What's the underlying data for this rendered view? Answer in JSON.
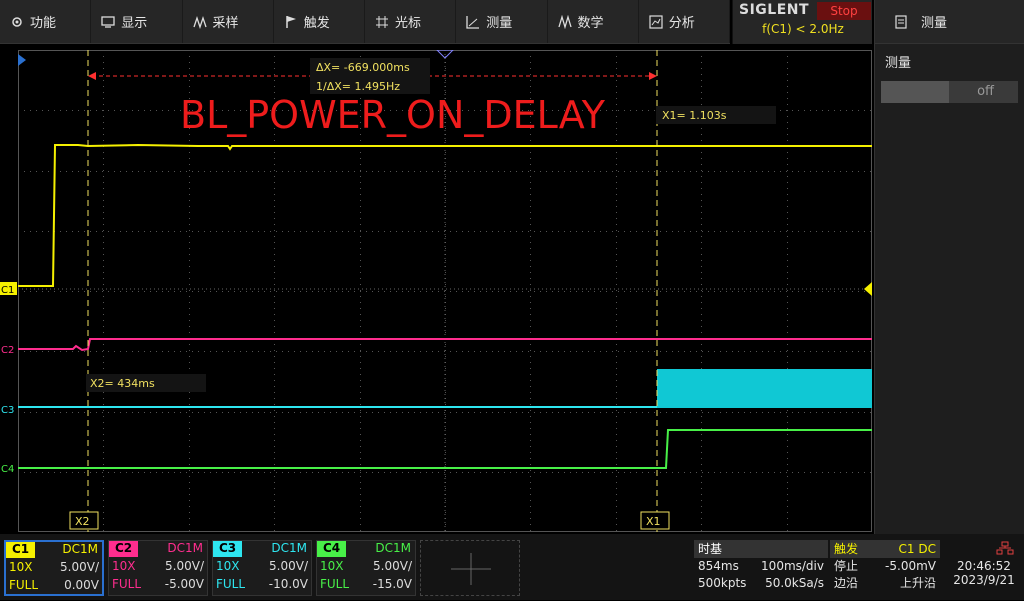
{
  "menu": [
    {
      "label": "功能",
      "icon": "gear-icon"
    },
    {
      "label": "显示",
      "icon": "monitor-icon"
    },
    {
      "label": "采样",
      "icon": "acquire-icon"
    },
    {
      "label": "触发",
      "icon": "flag-icon"
    },
    {
      "label": "光标",
      "icon": "cursor-icon"
    },
    {
      "label": "测量",
      "icon": "measure-icon"
    },
    {
      "label": "数学",
      "icon": "math-icon"
    },
    {
      "label": "分析",
      "icon": "analysis-icon"
    }
  ],
  "brand": {
    "name": "SIGLENT",
    "state": "Stop",
    "trigger_freq": "f(C1) < 2.0Hz"
  },
  "right_panel": {
    "title": "测量",
    "section": "测量",
    "toggle_value": "off"
  },
  "screen": {
    "title_annotation": "BL_POWER_ON_DELAY",
    "delta_x": "ΔX= -669.000ms",
    "inv_delta_x": "1/ΔX= 1.495Hz",
    "x1_label": "X1= 1.103s",
    "x2_label": "X2= 434ms",
    "x1_tag": "X1",
    "x2_tag": "X2",
    "ch_labels": [
      "C1",
      "C2",
      "C3",
      "C4"
    ]
  },
  "channels": [
    {
      "name": "C1",
      "coupling": "DC1M",
      "probe": "10X",
      "scale": "5.00V/",
      "bw": "FULL",
      "offset": "0.00V",
      "color": "#f5f000"
    },
    {
      "name": "C2",
      "coupling": "DC1M",
      "probe": "10X",
      "scale": "5.00V/",
      "bw": "FULL",
      "offset": "-5.00V",
      "color": "#ff2d8e"
    },
    {
      "name": "C3",
      "coupling": "DC1M",
      "probe": "10X",
      "scale": "5.00V/",
      "bw": "FULL",
      "offset": "-10.0V",
      "color": "#2ee6f0"
    },
    {
      "name": "C4",
      "coupling": "DC1M",
      "probe": "10X",
      "scale": "5.00V/",
      "bw": "FULL",
      "offset": "-15.0V",
      "color": "#48f048"
    }
  ],
  "timebase": {
    "label": "时基",
    "delay": "854ms",
    "scale": "100ms/div",
    "points": "500kpts",
    "rate": "50.0kSa/s"
  },
  "trigger": {
    "label": "触发",
    "source": "C1 DC",
    "state": "停止",
    "level": "-5.00mV",
    "type": "边沿",
    "slope": "上升沿"
  },
  "clock": {
    "time": "20:46:52",
    "date": "2023/9/21"
  }
}
